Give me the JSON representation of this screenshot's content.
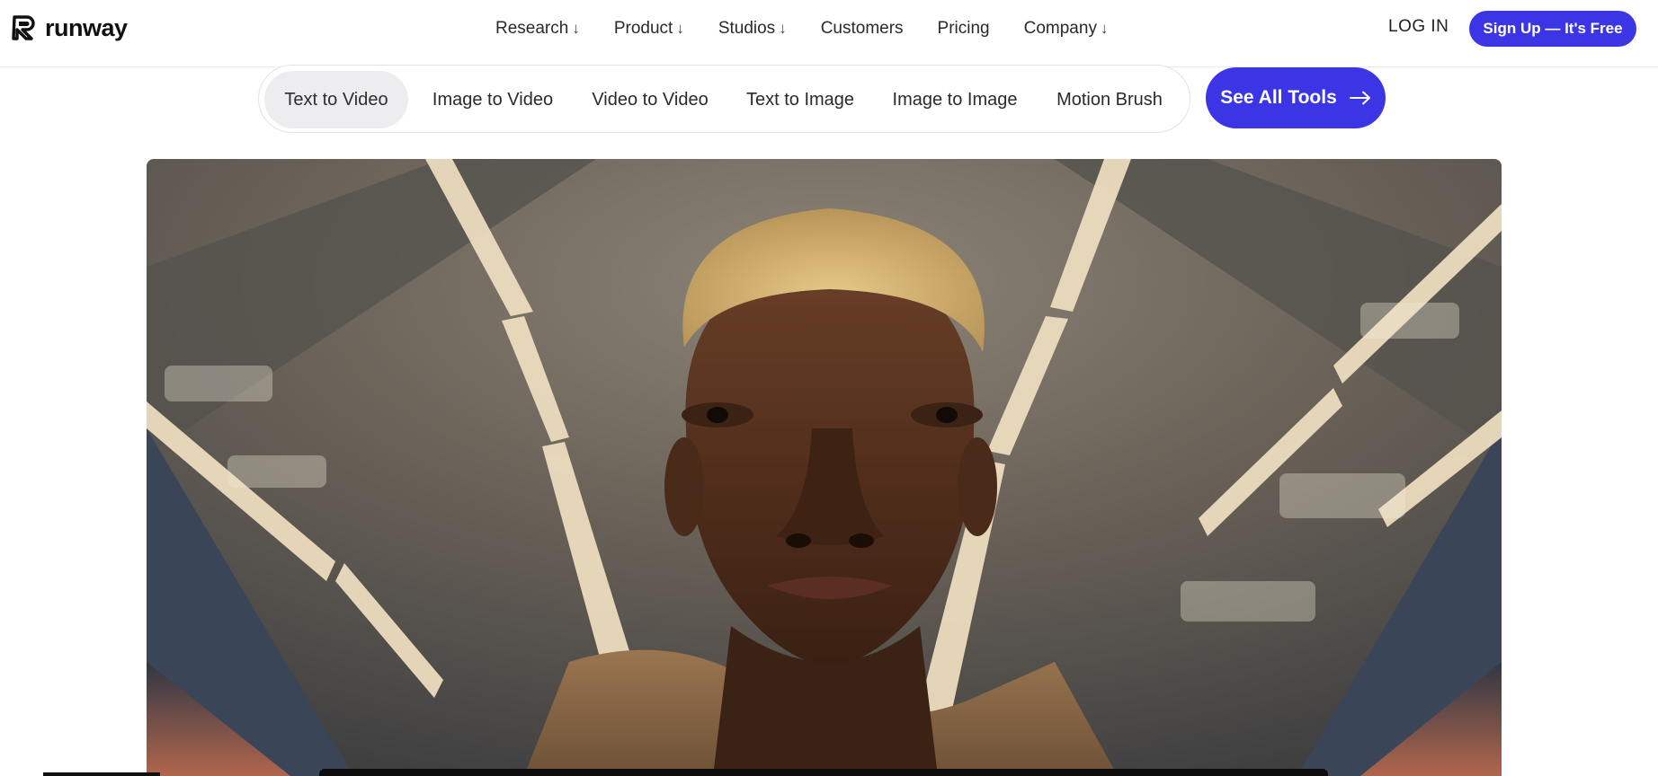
{
  "header": {
    "logo_text": "runway",
    "nav": [
      {
        "label": "Research",
        "arrow": "↓"
      },
      {
        "label": "Product",
        "arrow": "↓"
      },
      {
        "label": "Studios",
        "arrow": "↓"
      },
      {
        "label": "Customers",
        "arrow": ""
      },
      {
        "label": "Pricing",
        "arrow": ""
      },
      {
        "label": "Company",
        "arrow": "↓"
      }
    ],
    "login_label": "LOG IN",
    "signup_label": "Sign Up — It's Free"
  },
  "tools": {
    "items": [
      {
        "label": "Text to Video",
        "active": true
      },
      {
        "label": "Image to Video",
        "active": false
      },
      {
        "label": "Video to Video",
        "active": false
      },
      {
        "label": "Text to Image",
        "active": false
      },
      {
        "label": "Image to Image",
        "active": false
      },
      {
        "label": "Motion Brush",
        "active": false
      }
    ],
    "see_all_label": "See All Tools"
  },
  "hero": {
    "media": "video-frame-portrait"
  },
  "colors": {
    "accent": "#3c35e6",
    "active_pill": "#ededef"
  }
}
